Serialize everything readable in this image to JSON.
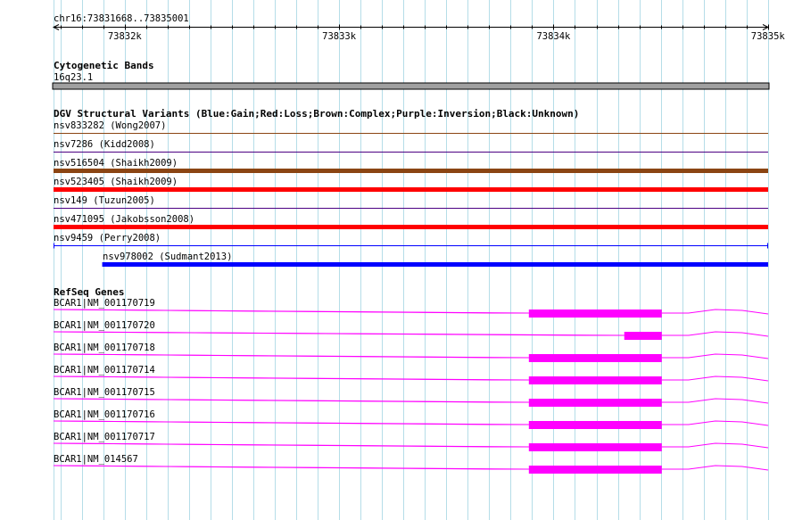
{
  "location": "chr16:73831668..73835001",
  "ruler": {
    "start": 73831668,
    "end": 73835001,
    "major_ticks": [
      {
        "pos": 73832000,
        "label": "73832k"
      },
      {
        "pos": 73833000,
        "label": "73833k"
      },
      {
        "pos": 73834000,
        "label": "73834k"
      },
      {
        "pos": 73835000,
        "label": "73835k"
      }
    ]
  },
  "cytoband": {
    "title": "Cytogenetic Bands",
    "band_name": "16q23.1",
    "color": "#a0a0a0"
  },
  "dgv": {
    "title": "DGV Structural Variants (Blue:Gain;Red:Loss;Brown:Complex;Purple:Inversion;Black:Unknown)",
    "items": [
      {
        "label": "nsv833282 (Wong2007)",
        "type": "Brown",
        "color": "#8b4513",
        "start": 73831668,
        "end": 73835001,
        "bar": "thin"
      },
      {
        "label": "nsv7286 (Kidd2008)",
        "type": "Purple",
        "color": "#4b0082",
        "start": 73831668,
        "end": 73835001,
        "bar": "thin"
      },
      {
        "label": "nsv516504 (Shaikh2009)",
        "type": "Brown",
        "color": "#8b4513",
        "start": 73831668,
        "end": 73835001,
        "bar": "thick"
      },
      {
        "label": "nsv523405 (Shaikh2009)",
        "type": "Red",
        "color": "#ff0000",
        "start": 73831668,
        "end": 73835001,
        "bar": "thick"
      },
      {
        "label": "nsv149 (Tuzun2005)",
        "type": "Purple",
        "color": "#4b0082",
        "start": 73831668,
        "end": 73835001,
        "bar": "thin"
      },
      {
        "label": "nsv471095 (Jakobsson2008)",
        "type": "Red",
        "color": "#ff0000",
        "start": 73831668,
        "end": 73835001,
        "bar": "thick"
      },
      {
        "label": "nsv9459 (Perry2008)",
        "type": "Blue",
        "color": "#0000ff",
        "start": 73831668,
        "end": 73835001,
        "bar": "bracket"
      },
      {
        "label": "nsv978002 (Sudmant2013)",
        "type": "Blue",
        "color": "#0000ff",
        "start": 73831895,
        "end": 73835001,
        "bar": "thick"
      }
    ]
  },
  "refseq": {
    "title": "RefSeq Genes",
    "color": "#ff00ff",
    "genes": [
      {
        "label": "BCAR1|NM_001170719",
        "exon": [
          73833885,
          73834505
        ]
      },
      {
        "label": "BCAR1|NM_001170720",
        "exon": [
          73834330,
          73834505
        ]
      },
      {
        "label": "BCAR1|NM_001170718",
        "exon": [
          73833885,
          73834505
        ]
      },
      {
        "label": "BCAR1|NM_001170714",
        "exon": [
          73833885,
          73834505
        ]
      },
      {
        "label": "BCAR1|NM_001170715",
        "exon": [
          73833885,
          73834505
        ]
      },
      {
        "label": "BCAR1|NM_001170716",
        "exon": [
          73833885,
          73834505
        ]
      },
      {
        "label": "BCAR1|NM_001170717",
        "exon": [
          73833885,
          73834505
        ]
      },
      {
        "label": "BCAR1|NM_014567",
        "exon": [
          73833885,
          73834505
        ]
      }
    ]
  }
}
